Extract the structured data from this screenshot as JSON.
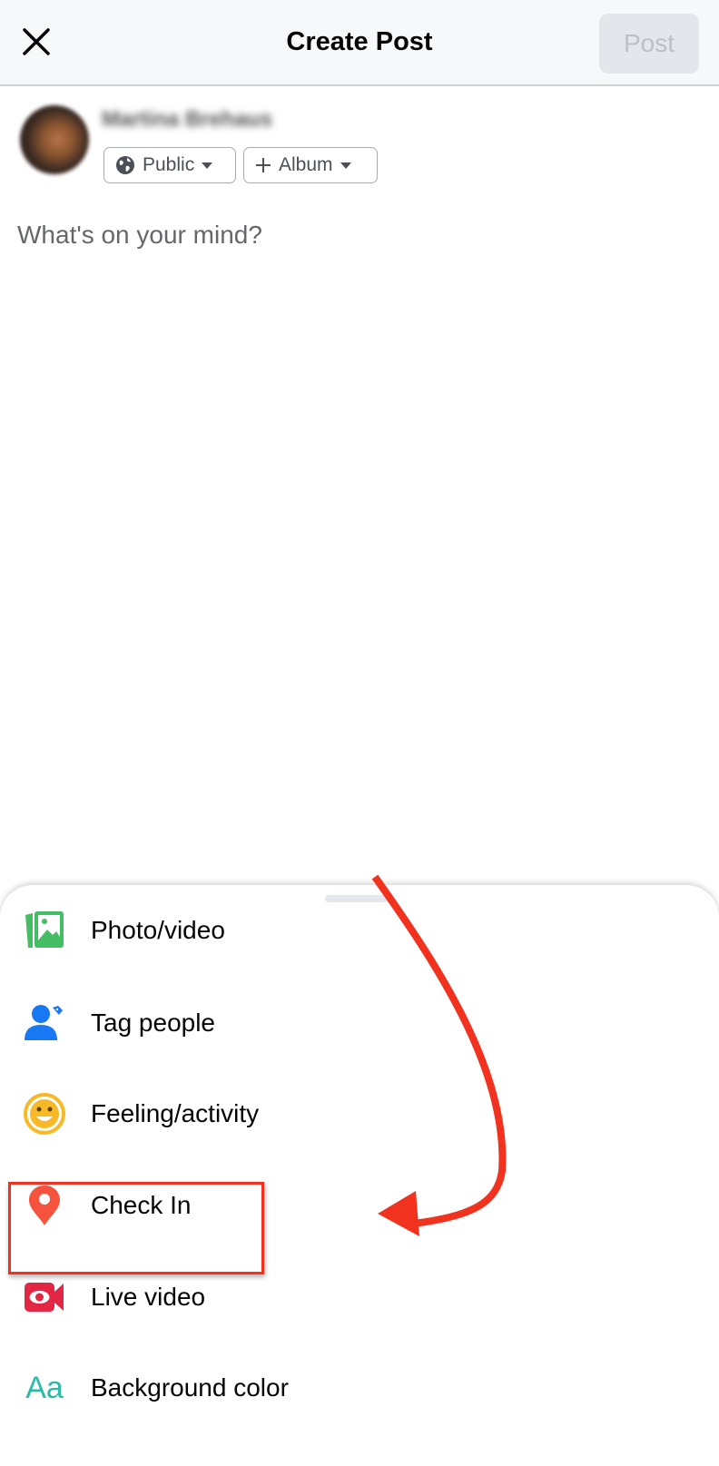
{
  "header": {
    "close_icon": "close-icon",
    "title": "Create Post",
    "post_label": "Post"
  },
  "author": {
    "name": "Martina Brehaus",
    "name_obscured": true,
    "audience_label": "Public",
    "audience_icon": "globe-icon",
    "album_label": "Album",
    "album_icon": "plus-icon"
  },
  "composer": {
    "placeholder": "What's on your mind?"
  },
  "options": [
    {
      "label": "Photo/video",
      "icon": "photo-icon",
      "color": "#45bd62"
    },
    {
      "label": "Tag people",
      "icon": "tag-people-icon",
      "color": "#1877f2"
    },
    {
      "label": "Feeling/activity",
      "icon": "smiley-icon",
      "color": "#f7b928"
    },
    {
      "label": "Check In",
      "icon": "location-pin-icon",
      "color": "#f5533d",
      "highlighted": true
    },
    {
      "label": "Live video",
      "icon": "live-video-icon",
      "color": "#e42645"
    },
    {
      "label": "Background color",
      "icon": "text-aa-icon",
      "color": "#2abba7"
    }
  ],
  "annotation": {
    "highlight_color": "#f0321e",
    "target": "Check In"
  }
}
